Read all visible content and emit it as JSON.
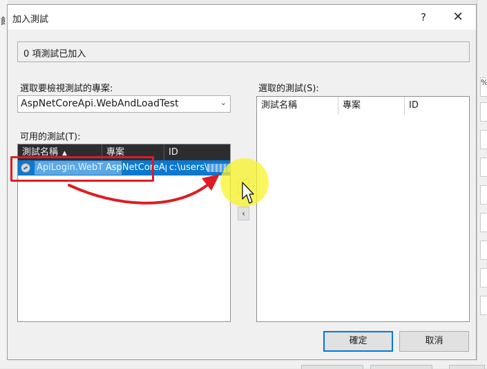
{
  "dialog": {
    "title": "加入測試",
    "help_label": "?",
    "close_label": "✕"
  },
  "status": {
    "text": "0 項測試已加入"
  },
  "project": {
    "label": "選取要檢視測試的專案:",
    "selected": "AspNetCoreApi.WebAndLoadTest"
  },
  "available": {
    "label": "可用的測試(T):",
    "columns": [
      "測試名稱",
      "專案",
      "ID"
    ],
    "sort_arrow": "▲",
    "rows": [
      {
        "name": "ApiLogin.WebT",
        "project": "AspNetCoreAp",
        "id": "c:\\users\\"
      }
    ]
  },
  "selected_tests": {
    "label": "選取的測試(S):",
    "columns": [
      "測試名稱",
      "專案",
      "ID"
    ]
  },
  "move": {
    "right_label": "›",
    "left_label": "‹"
  },
  "buttons": {
    "ok": "確定",
    "cancel": "取消"
  },
  "background": {
    "left_glyph": "飠",
    "right_glyph": "%"
  },
  "colors": {
    "selection": "#0b79d0",
    "header_dark": "#2d2d30",
    "annotation_red": "#e01b24",
    "cursor_highlight": "#f8f428",
    "ok_border": "#0078d7"
  }
}
